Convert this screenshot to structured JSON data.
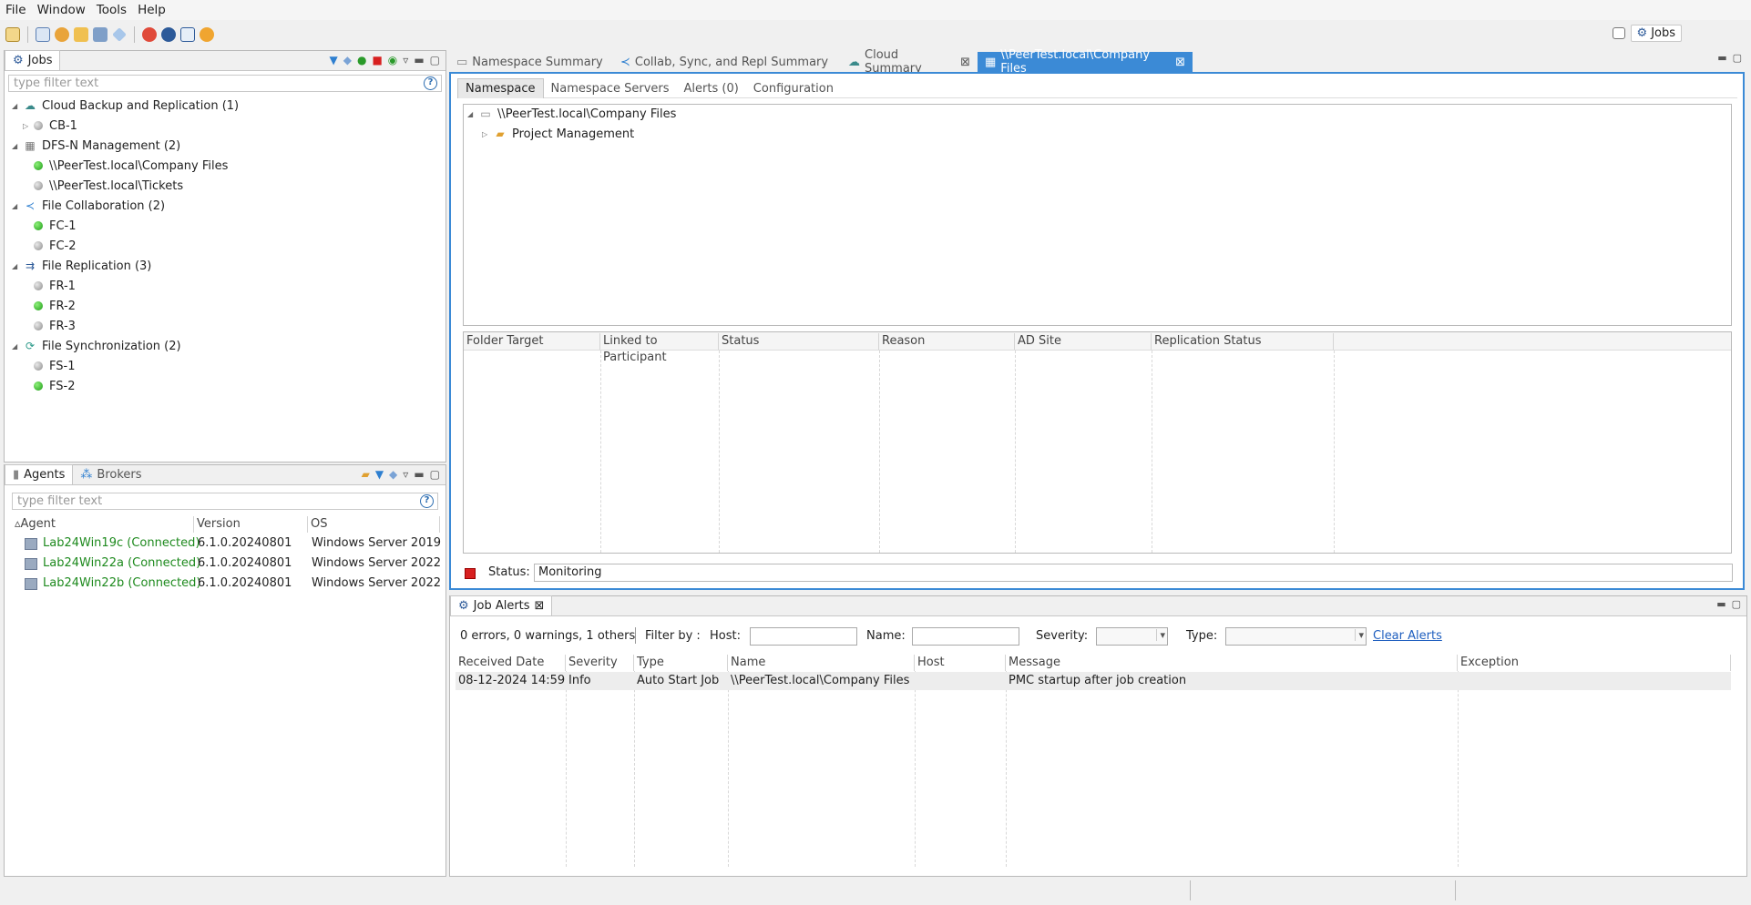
{
  "menu": [
    "File",
    "Window",
    "Tools",
    "Help"
  ],
  "perspective": {
    "label": "Jobs"
  },
  "jobs_panel": {
    "tab": "Jobs",
    "filter_placeholder": "type filter text",
    "tree": [
      {
        "label": "Cloud Backup and Replication (1)",
        "level": 0
      },
      {
        "label": "CB-1",
        "level": 1,
        "status": "gray"
      },
      {
        "label": "DFS-N Management (2)",
        "level": 0
      },
      {
        "label": "\\\\PeerTest.local\\Company Files",
        "level": 1,
        "status": "green"
      },
      {
        "label": "\\\\PeerTest.local\\Tickets",
        "level": 1,
        "status": "gray"
      },
      {
        "label": "File Collaboration (2)",
        "level": 0
      },
      {
        "label": "FC-1",
        "level": 1,
        "status": "green"
      },
      {
        "label": "FC-2",
        "level": 1,
        "status": "gray"
      },
      {
        "label": "File Replication (3)",
        "level": 0
      },
      {
        "label": "FR-1",
        "level": 1,
        "status": "gray"
      },
      {
        "label": "FR-2",
        "level": 1,
        "status": "green"
      },
      {
        "label": "FR-3",
        "level": 1,
        "status": "gray"
      },
      {
        "label": "File Synchronization (2)",
        "level": 0
      },
      {
        "label": "FS-1",
        "level": 1,
        "status": "gray"
      },
      {
        "label": "FS-2",
        "level": 1,
        "status": "green"
      }
    ]
  },
  "agents_panel": {
    "tabs": [
      "Agents",
      "Brokers"
    ],
    "filter_placeholder": "type filter text",
    "columns": [
      "Agent",
      "Version",
      "OS"
    ],
    "rows": [
      [
        "Lab24Win19c (Connected)",
        "6.1.0.20240801",
        "Windows Server 2019"
      ],
      [
        "Lab24Win22a (Connected)",
        "6.1.0.20240801",
        "Windows Server 2022"
      ],
      [
        "Lab24Win22b (Connected)",
        "6.1.0.20240801",
        "Windows Server 2022"
      ]
    ]
  },
  "editor_tabs": [
    "Namespace Summary",
    "Collab, Sync, and Repl Summary",
    "Cloud Summary",
    "\\\\PeerTest.local\\Company Files"
  ],
  "sub_tabs": [
    "Namespace",
    "Namespace Servers",
    "Alerts (0)",
    "Configuration"
  ],
  "namespace_tree": {
    "root": "\\\\PeerTest.local\\Company Files",
    "child": "Project Management"
  },
  "folder_columns": [
    "Folder Target",
    "Linked to Participant",
    "Status",
    "Reason",
    "AD Site",
    "Replication Status"
  ],
  "status": {
    "label": "Status:",
    "value": "Monitoring"
  },
  "alerts": {
    "tab": "Job Alerts",
    "summary": "0 errors, 0 warnings, 1 others",
    "filter_by": "Filter by :",
    "host_label": "Host:",
    "name_label": "Name:",
    "severity_label": "Severity:",
    "type_label": "Type:",
    "clear": "Clear Alerts",
    "columns": [
      "Received Date",
      "Severity",
      "Type",
      "Name",
      "Host",
      "Message",
      "Exception"
    ],
    "rows": [
      [
        "08-12-2024 14:59",
        "Info",
        "Auto Start Job",
        "\\\\PeerTest.local\\Company Files",
        "",
        "PMC startup after job creation",
        ""
      ]
    ]
  }
}
